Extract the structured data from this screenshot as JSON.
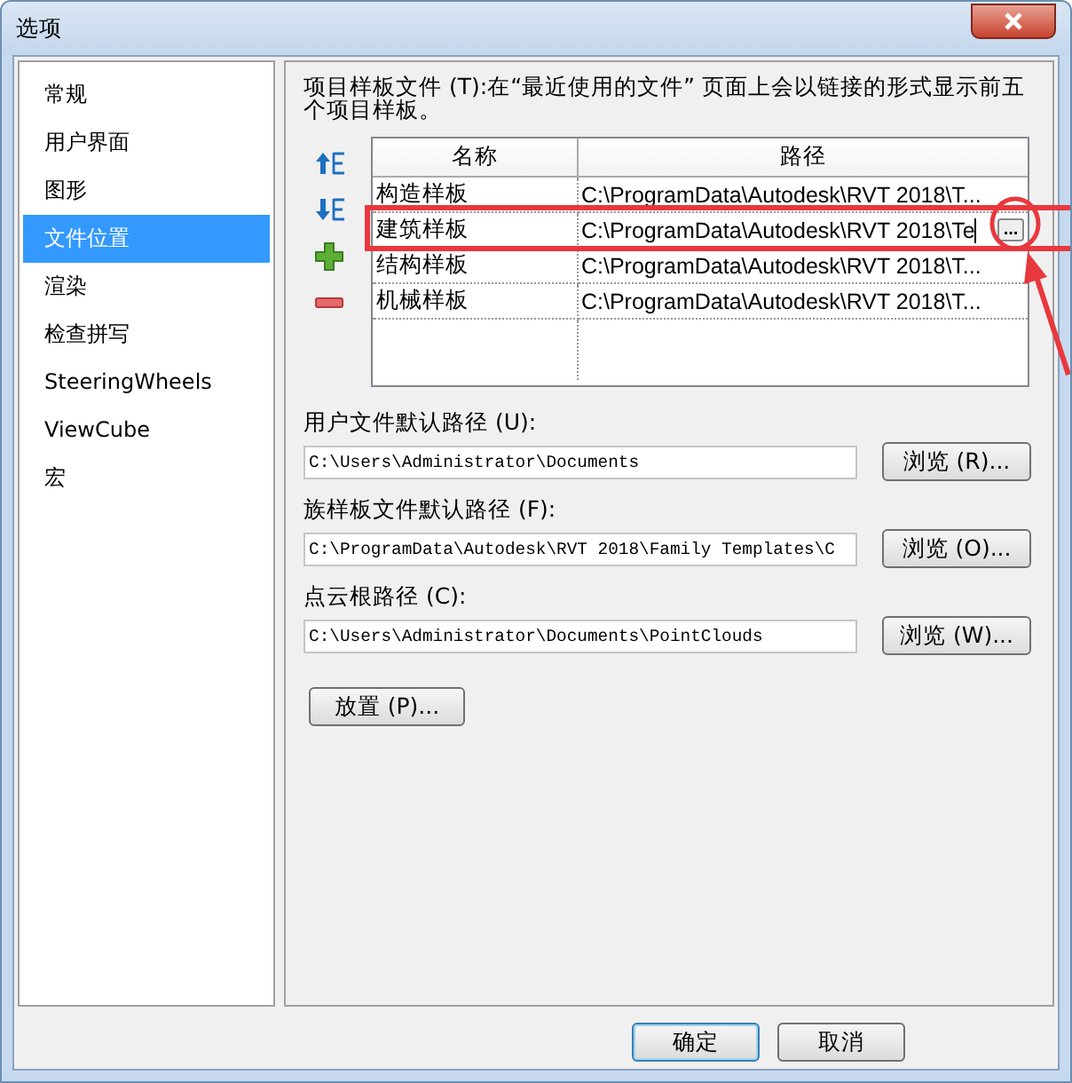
{
  "window": {
    "title": "选项"
  },
  "sidebar": {
    "items": [
      {
        "label": "常规",
        "selected": false
      },
      {
        "label": "用户界面",
        "selected": false
      },
      {
        "label": "图形",
        "selected": false
      },
      {
        "label": "文件位置",
        "selected": true
      },
      {
        "label": "渲染",
        "selected": false
      },
      {
        "label": "检查拼写",
        "selected": false
      },
      {
        "label": "SteeringWheels",
        "selected": false
      },
      {
        "label": "ViewCube",
        "selected": false
      },
      {
        "label": "宏",
        "selected": false
      }
    ]
  },
  "templates": {
    "description": "项目样板文件 (T):在“最近使用的文件” 页面上会以链接的形式显示前五个项目样板。",
    "toolbar": [
      {
        "kind": "move-up"
      },
      {
        "kind": "move-down"
      },
      {
        "kind": "add"
      },
      {
        "kind": "remove"
      }
    ],
    "columns": [
      "名称",
      "路径"
    ],
    "rows": [
      {
        "name": "构造样板",
        "path": "C:\\ProgramData\\Autodesk\\RVT 2018\\T...",
        "editing": false
      },
      {
        "name": "建筑样板",
        "path": "C:\\ProgramData\\Autodesk\\RVT 2018\\Te",
        "editing": true,
        "edit_button": "..."
      },
      {
        "name": "结构样板",
        "path": "C:\\ProgramData\\Autodesk\\RVT 2018\\T...",
        "editing": false
      },
      {
        "name": "机械样板",
        "path": "C:\\ProgramData\\Autodesk\\RVT 2018\\T...",
        "editing": false
      }
    ]
  },
  "path_fields": [
    {
      "label": "用户文件默认路径 (U):",
      "value": "C:\\Users\\Administrator\\Documents",
      "button": "浏览 (R)..."
    },
    {
      "label": "族样板文件默认路径 (F):",
      "value": "C:\\ProgramData\\Autodesk\\RVT 2018\\Family Templates\\C",
      "button": "浏览 (O)..."
    },
    {
      "label": "点云根路径 (C):",
      "value": "C:\\Users\\Administrator\\Documents\\PointClouds",
      "button": "浏览 (W)..."
    }
  ],
  "place_button": "放置 (P)...",
  "footer_buttons": [
    {
      "label": "确定",
      "default": true
    },
    {
      "label": "取消",
      "default": false
    }
  ],
  "annotations": [
    {
      "kind": "box"
    },
    {
      "kind": "circle"
    },
    {
      "kind": "arrow"
    }
  ]
}
